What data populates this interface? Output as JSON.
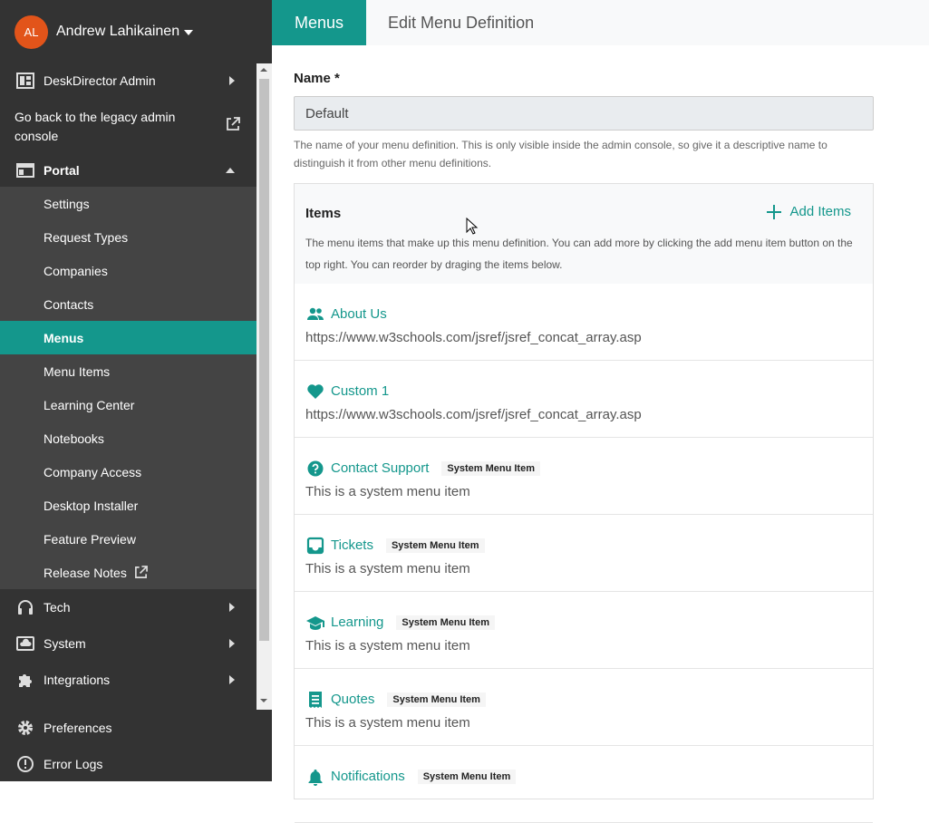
{
  "user": {
    "initials": "AL",
    "name": "Andrew Lahikainen"
  },
  "sidebar": {
    "deskdirector_admin": "DeskDirector Admin",
    "legacy_link": "Go back to the legacy admin console",
    "portal": "Portal",
    "portal_items": [
      "Settings",
      "Request Types",
      "Companies",
      "Contacts",
      "Menus",
      "Menu Items",
      "Learning Center",
      "Notebooks",
      "Company Access",
      "Desktop Installer",
      "Feature Preview",
      "Release Notes"
    ],
    "tech": "Tech",
    "system": "System",
    "integrations": "Integrations",
    "preferences": "Preferences",
    "error_logs": "Error Logs"
  },
  "tabs": {
    "menus": "Menus",
    "edit": "Edit Menu Definition"
  },
  "form": {
    "name_label": "Name *",
    "name_value": "Default",
    "name_help": "The name of your menu definition. This is only visible inside the admin console, so give it a descriptive name to distinguish it from other menu definitions."
  },
  "items": {
    "title": "Items",
    "add_label": "Add Items",
    "help": "The menu items that make up this menu definition. You can add more by clicking the add menu item button on the top right. You can reorder by draging the items below.",
    "list": [
      {
        "title": "About Us",
        "sub": "https://www.w3schools.com/jsref/jsref_concat_array.asp",
        "badge": "",
        "icon": "people-icon"
      },
      {
        "title": "Custom 1",
        "sub": "https://www.w3schools.com/jsref/jsref_concat_array.asp",
        "badge": "",
        "icon": "heart-icon"
      },
      {
        "title": "Contact Support",
        "sub": "This is a system menu item",
        "badge": "System Menu Item",
        "icon": "help-circle-icon"
      },
      {
        "title": "Tickets",
        "sub": "This is a system menu item",
        "badge": "System Menu Item",
        "icon": "inbox-icon"
      },
      {
        "title": "Learning",
        "sub": "This is a system menu item",
        "badge": "System Menu Item",
        "icon": "graduation-cap-icon"
      },
      {
        "title": "Quotes",
        "sub": "This is a system menu item",
        "badge": "System Menu Item",
        "icon": "receipt-icon"
      },
      {
        "title": "Notifications",
        "sub": "",
        "badge": "System Menu Item",
        "icon": "bell-icon"
      }
    ]
  },
  "colors": {
    "accent": "#14978c",
    "sidebar": "#333333",
    "sidebar_sub": "#444444",
    "avatar": "#e2541a"
  }
}
